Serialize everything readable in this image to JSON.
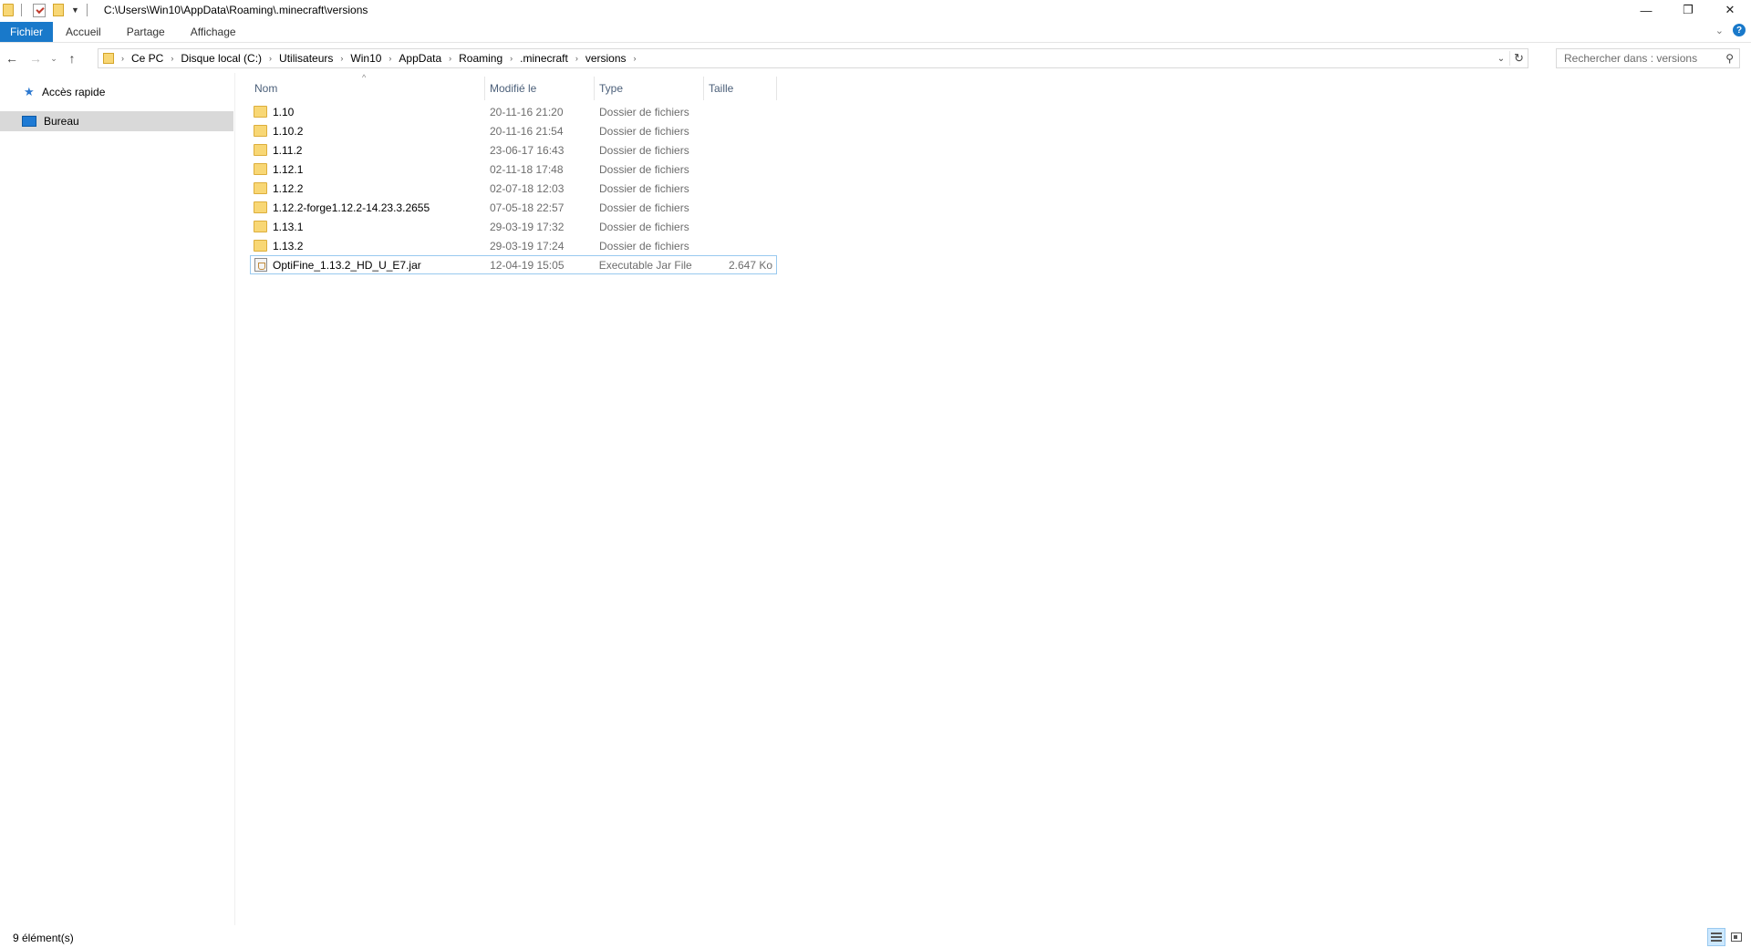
{
  "window": {
    "title": "C:\\Users\\Win10\\AppData\\Roaming\\.minecraft\\versions",
    "controls": {
      "minimize": "—",
      "restore": "❐",
      "close": "✕"
    }
  },
  "ribbon": {
    "tabs": [
      "Fichier",
      "Accueil",
      "Partage",
      "Affichage"
    ],
    "help": "?"
  },
  "navigation": {
    "back": "←",
    "forward": "→",
    "recent": "⌄",
    "up": "↑",
    "breadcrumb": [
      "Ce PC",
      "Disque local (C:)",
      "Utilisateurs",
      "Win10",
      "AppData",
      "Roaming",
      ".minecraft",
      "versions"
    ],
    "search_placeholder": "Rechercher dans : versions"
  },
  "nav_pane": {
    "items": [
      {
        "label": "Accès rapide",
        "icon": "star-icon"
      },
      {
        "label": "Bureau",
        "icon": "desktop-icon",
        "selected": true
      }
    ]
  },
  "file_list": {
    "columns": {
      "name": "Nom",
      "date": "Modifié le",
      "type": "Type",
      "size": "Taille"
    },
    "sort_column": "Nom",
    "rows": [
      {
        "name": "1.10",
        "date": "20-11-16 21:20",
        "type": "Dossier de fichiers",
        "size": "",
        "icon": "folder-icon"
      },
      {
        "name": "1.10.2",
        "date": "20-11-16 21:54",
        "type": "Dossier de fichiers",
        "size": "",
        "icon": "folder-icon"
      },
      {
        "name": "1.11.2",
        "date": "23-06-17 16:43",
        "type": "Dossier de fichiers",
        "size": "",
        "icon": "folder-icon"
      },
      {
        "name": "1.12.1",
        "date": "02-11-18 17:48",
        "type": "Dossier de fichiers",
        "size": "",
        "icon": "folder-icon"
      },
      {
        "name": "1.12.2",
        "date": "02-07-18 12:03",
        "type": "Dossier de fichiers",
        "size": "",
        "icon": "folder-icon"
      },
      {
        "name": "1.12.2-forge1.12.2-14.23.3.2655",
        "date": "07-05-18 22:57",
        "type": "Dossier de fichiers",
        "size": "",
        "icon": "folder-icon"
      },
      {
        "name": "1.13.1",
        "date": "29-03-19 17:32",
        "type": "Dossier de fichiers",
        "size": "",
        "icon": "folder-icon"
      },
      {
        "name": "1.13.2",
        "date": "29-03-19 17:24",
        "type": "Dossier de fichiers",
        "size": "",
        "icon": "folder-icon"
      },
      {
        "name": "OptiFine_1.13.2_HD_U_E7.jar",
        "date": "12-04-19 15:05",
        "type": "Executable Jar File",
        "size": "2.647 Ko",
        "icon": "jar-file-icon",
        "focused": true
      }
    ]
  },
  "status_bar": {
    "item_count": "9 élément(s)",
    "view_mode": "details"
  }
}
